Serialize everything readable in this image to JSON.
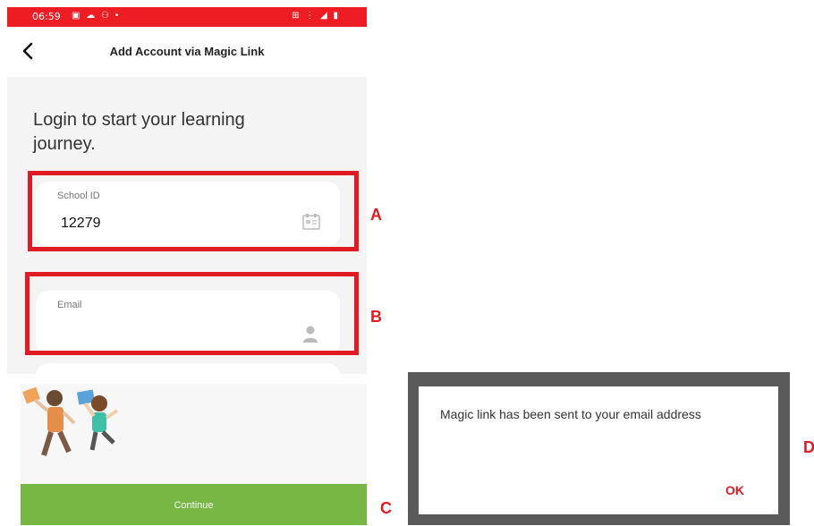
{
  "status_bar": {
    "time": "06:59",
    "left_icons": "▣ ☁ ⚇ •",
    "right_icons": "⊞ ⋮ ◢ ▮"
  },
  "header": {
    "title": "Add Account via Magic Link"
  },
  "headline": "Login to start your learning journey.",
  "fields": {
    "school_id": {
      "label": "School ID",
      "value": "12279"
    },
    "email": {
      "label": "Email",
      "value": ""
    }
  },
  "annotations": {
    "a": "A",
    "b": "B",
    "c": "C",
    "d": "D"
  },
  "continue_label": "Continue",
  "dialog": {
    "message": "Magic link has been sent to your email address",
    "ok_label": "OK"
  },
  "colors": {
    "brand_red": "#ee1d23",
    "continue_green": "#76b743",
    "annotation_red": "#e01b24"
  }
}
